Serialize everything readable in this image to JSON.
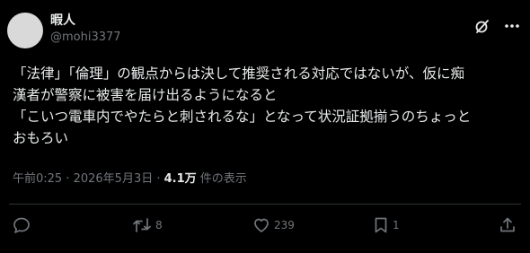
{
  "author": {
    "display_name": "暇人",
    "handle": "@mohi3377"
  },
  "post": {
    "text": "「法律」「倫理」の観点からは決して推奨される対応ではないが、仮に痴\n漢者が警察に被害を届け出るようになると\n「こいつ電車内でやたらと刺されるな」となって状況証拠揃うのちょっと\nおもろい",
    "timestamp": "午前0:25 · 2026年5月3日 · ",
    "views_count": "4.1万",
    "views_label": " 件の表示"
  },
  "actions": {
    "reply_count": "",
    "repost_count": "8",
    "like_count": "239",
    "bookmark_count": "1"
  },
  "colors": {
    "background": "#000000",
    "text": "#e7e9ea",
    "muted": "#71767b",
    "divider": "#2f3336"
  },
  "icons": [
    "grok-icon",
    "more-icon",
    "reply-icon",
    "repost-icon",
    "like-icon",
    "bookmark-icon",
    "share-icon"
  ]
}
